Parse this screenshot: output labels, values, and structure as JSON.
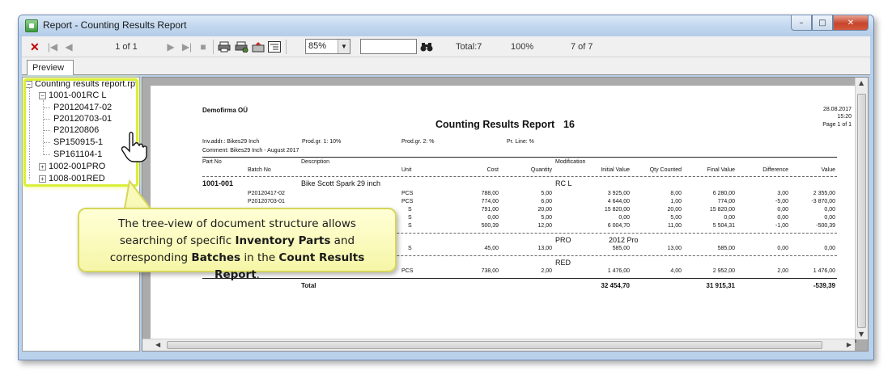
{
  "window": {
    "title": "Report - Counting Results Report",
    "controls": {
      "minimize": "–",
      "maximize": "□",
      "close": "✕"
    }
  },
  "toolbar": {
    "close_label": "✕",
    "page_indicator": "1 of 1",
    "zoom_value": "85%",
    "total_label": "Total:7",
    "percent_label": "100%",
    "count_label": "7 of 7"
  },
  "tabs": {
    "preview": "Preview"
  },
  "tree": {
    "root": "Counting results report.rpt",
    "groups": [
      {
        "label": "1001-001RC L",
        "children": [
          "P20120417-02",
          "P20120703-01",
          "P20120806",
          "SP150915-1",
          "SP161104-1"
        ]
      },
      {
        "label": "1002-001PRO"
      },
      {
        "label": "1008-001RED"
      }
    ]
  },
  "report": {
    "company": "Demofirma OÜ",
    "title": "Counting Results Report",
    "number": "16",
    "date": "28.08.2017",
    "time": "15:20",
    "page": "Page 1 of 1",
    "inv_addr": "Inv.addr.: Bikes29 Inch",
    "prod_gr1": "Prod.gr. 1: 10%",
    "prod_gr2": "Prod.gr. 2: %",
    "pr_line": "Pr. Line: %",
    "comment": "Comment: Bikes29 Inch - August 2017",
    "headers": {
      "part_no": "Part No",
      "batch_no": "Batch No",
      "description": "Description",
      "unit": "Unit",
      "cost": "Cost",
      "quantity": "Quantity",
      "modification": "Modification",
      "initial_value": "Initial Value",
      "qty_counted": "Qty Counted",
      "final_value": "Final Value",
      "difference": "Difference",
      "value": "Value"
    },
    "part1": {
      "part_no": "1001-001",
      "description": "Bike Scott Spark 29 inch",
      "modification": "RC L"
    },
    "rows1": [
      {
        "batch": "P20120417-02",
        "unit": "PCS",
        "cost": "788,00",
        "qty": "5,00",
        "initial": "3 925,00",
        "counted": "8,00",
        "final": "6 280,00",
        "diff": "3,00",
        "value": "2 355,00"
      },
      {
        "batch": "P20120703-01",
        "unit": "PCS",
        "cost": "774,00",
        "qty": "6,00",
        "initial": "4 644,00",
        "counted": "1,00",
        "final": "774,00",
        "diff": "-5,00",
        "value": "-3 870,00"
      },
      {
        "batch": "",
        "unit": "S",
        "cost": "791,00",
        "qty": "20,00",
        "initial": "15 820,00",
        "counted": "20,00",
        "final": "15 820,00",
        "diff": "0,00",
        "value": "0,00"
      },
      {
        "batch": "",
        "unit": "S",
        "cost": "0,00",
        "qty": "5,00",
        "initial": "0,00",
        "counted": "5,00",
        "final": "0,00",
        "diff": "0,00",
        "value": "0,00"
      },
      {
        "batch": "",
        "unit": "S",
        "cost": "500,39",
        "qty": "12,00",
        "initial": "6 004,70",
        "counted": "11,00",
        "final": "5 504,31",
        "diff": "-1,00",
        "value": "-500,39"
      }
    ],
    "part2": {
      "modification": "PRO",
      "modification2": "2012 Pro"
    },
    "row2": {
      "unit": "S",
      "cost": "45,00",
      "qty": "13,00",
      "initial": "585,00",
      "counted": "13,00",
      "final": "585,00",
      "diff": "0,00",
      "value": "0,00"
    },
    "part3": {
      "modification": "RED"
    },
    "row3": {
      "batch": "P20130520-01",
      "unit": "PCS",
      "cost": "738,00",
      "qty": "2,00",
      "initial": "1 476,00",
      "counted": "4,00",
      "final": "2 952,00",
      "diff": "2,00",
      "value": "1 476,00"
    },
    "total": {
      "label": "Total",
      "initial": "32 454,70",
      "final": "31 915,31",
      "value": "-539,39"
    }
  },
  "callout": {
    "line1": "The tree-view of document structure allows",
    "line2_pre": "searching of specific ",
    "line2_bold": "Inventory Parts",
    "line2_post": " and",
    "line3_pre": "corresponding ",
    "line3_bold1": "Batches",
    "line3_mid": " in the ",
    "line3_bold2": "Count Results Report",
    "line3_post": "."
  },
  "colors": {
    "highlight": "#d9ef3a",
    "callout_bg": "#f6f6a8",
    "close_red": "#c7452b"
  }
}
